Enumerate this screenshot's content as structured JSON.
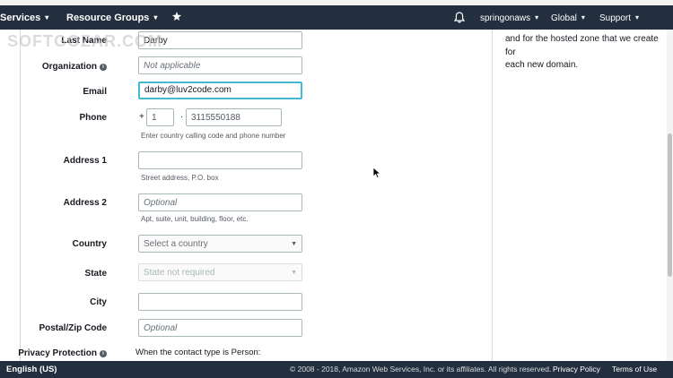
{
  "nav": {
    "services": "Services",
    "resource_groups": "Resource Groups",
    "account": "springonaws",
    "region": "Global",
    "support": "Support"
  },
  "help_panel": {
    "lines": [
      "and for the hosted zone that we create for",
      "each new domain."
    ]
  },
  "form": {
    "last_name": {
      "label": "Last Name",
      "value": "Darby"
    },
    "organization": {
      "label": "Organization",
      "placeholder": "Not applicable"
    },
    "email": {
      "label": "Email",
      "value": "darby@luv2code.com"
    },
    "phone": {
      "label": "Phone",
      "plus": "+",
      "dot": "·",
      "country_code": "1",
      "number": "3115550188",
      "hint": "Enter country calling code and phone number"
    },
    "address1": {
      "label": "Address 1",
      "hint": "Street address, P.O. box"
    },
    "address2": {
      "label": "Address 2",
      "placeholder": "Optional",
      "hint": "Apt, suite, unit, building, floor, etc."
    },
    "country": {
      "label": "Country",
      "selected": "Select a country"
    },
    "state": {
      "label": "State",
      "selected": "State not required"
    },
    "city": {
      "label": "City"
    },
    "postal": {
      "label": "Postal/Zip Code",
      "placeholder": "Optional"
    },
    "privacy": {
      "label": "Privacy Protection",
      "text": "When the contact type is Person:"
    }
  },
  "footer": {
    "language": "English (US)",
    "copyright": "© 2008 - 2018, Amazon Web Services, Inc. or its affiliates. All rights reserved.",
    "privacy_policy": "Privacy Policy",
    "terms": "Terms of Use"
  },
  "watermark": "SOFTGOZAR.COM",
  "colors": {
    "nav_bg": "#232f3e",
    "focus_border": "#44b9d6",
    "field_border": "#aab7b8"
  },
  "icons": [
    "pin-icon",
    "bell-icon",
    "info-icon",
    "mouse-cursor-icon"
  ]
}
